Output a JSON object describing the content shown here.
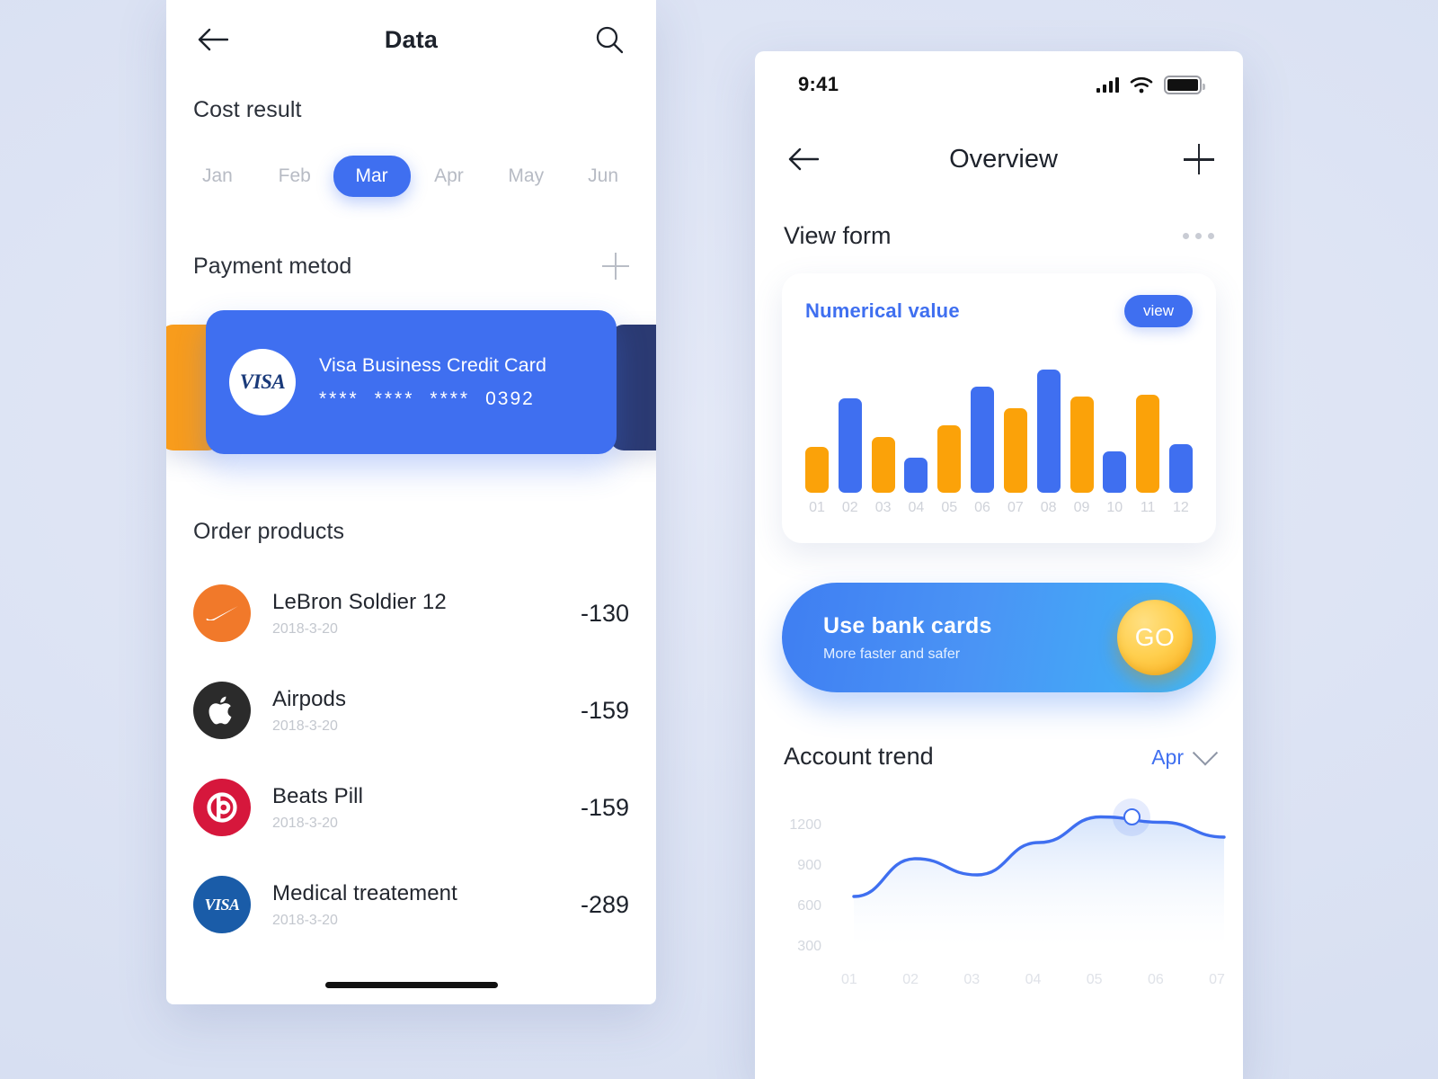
{
  "left_screen": {
    "nav": {
      "back_icon": "arrow-left-icon",
      "title": "Data",
      "search_icon": "search-icon"
    },
    "cost_result": {
      "title": "Cost result",
      "months": [
        "Jan",
        "Feb",
        "Mar",
        "Apr",
        "May",
        "Jun"
      ],
      "active_month": "Mar"
    },
    "payment_method": {
      "title": "Payment metod",
      "add_icon": "plus-icon",
      "card": {
        "brand": "VISA",
        "name": "Visa Business Credit Card",
        "masked_groups": [
          "****",
          "****",
          "****"
        ],
        "last4": "0392"
      }
    },
    "order_products": {
      "title": "Order products",
      "items": [
        {
          "logo": "nike-icon",
          "name": "LeBron Soldier 12",
          "date": "2018-3-20",
          "amount": "-130"
        },
        {
          "logo": "apple-icon",
          "name": "Airpods",
          "date": "2018-3-20",
          "amount": "-159"
        },
        {
          "logo": "beats-icon",
          "name": "Beats Pill",
          "date": "2018-3-20",
          "amount": "-159"
        },
        {
          "logo": "visa-icon",
          "name": "Medical treatement",
          "date": "2018-3-20",
          "amount": "-289"
        }
      ]
    }
  },
  "right_screen": {
    "status_bar": {
      "time": "9:41",
      "signal_icon": "cellular-signal-icon",
      "wifi_icon": "wifi-icon",
      "battery_icon": "battery-full-icon"
    },
    "nav": {
      "back_icon": "arrow-left-icon",
      "title": "Overview",
      "add_icon": "plus-icon"
    },
    "view_form": {
      "title": "View form",
      "more_icon": "more-horizontal-icon"
    },
    "numerical_card": {
      "title": "Numerical value",
      "view_label": "view"
    },
    "promo": {
      "title": "Use bank cards",
      "subtitle": "More faster and safer",
      "button_label": "GO"
    },
    "account_trend": {
      "title": "Account trend",
      "month": "Apr",
      "chevron_icon": "chevron-down-icon"
    }
  },
  "colors": {
    "accent_blue": "#3f6ff0",
    "bar_orange": "#fba209",
    "bar_blue": "#3f6ff0",
    "promo_gradient_start": "#3f7ef2",
    "promo_gradient_end": "#3fb6f7",
    "go_yellow": "#ffcf4e",
    "card_peek_orange": "#f89c1c",
    "card_peek_navy": "#2b3a72"
  },
  "chart_data": [
    {
      "type": "bar",
      "title": "Numerical value",
      "categories": [
        "01",
        "02",
        "03",
        "04",
        "05",
        "06",
        "07",
        "08",
        "09",
        "10",
        "11",
        "12"
      ],
      "values": [
        48,
        98,
        58,
        36,
        70,
        110,
        88,
        128,
        100,
        43,
        102,
        50
      ],
      "colors": [
        "#fba209",
        "#3f6ff0",
        "#fba209",
        "#3f6ff0",
        "#fba209",
        "#3f6ff0",
        "#fba209",
        "#3f6ff0",
        "#fba209",
        "#3f6ff0",
        "#fba209",
        "#3f6ff0"
      ],
      "xlabel": "",
      "ylabel": "",
      "ylim": [
        0,
        140
      ],
      "grid": false,
      "legend": "none"
    },
    {
      "type": "area",
      "title": "Account trend",
      "x": [
        "01",
        "02",
        "03",
        "04",
        "05",
        "06",
        "07"
      ],
      "values": [
        680,
        960,
        840,
        1080,
        1270,
        1230,
        1120
      ],
      "ytick_labels": [
        "1200",
        "900",
        "600",
        "300"
      ],
      "ylim": [
        300,
        1400
      ],
      "xlabel": "",
      "ylabel": "",
      "grid": false,
      "legend": "none",
      "highlight_point": {
        "x": "05",
        "value": 1270
      },
      "line_color": "#3f6ff0"
    }
  ]
}
